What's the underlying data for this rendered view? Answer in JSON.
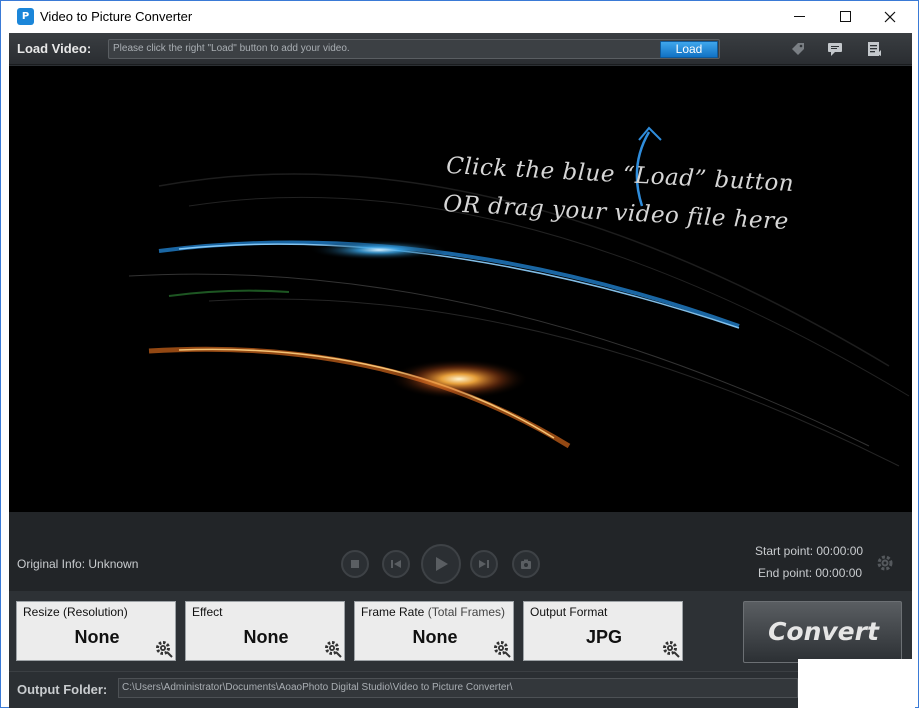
{
  "window": {
    "title": "Video to Picture Converter",
    "app_icon_glyph": "P",
    "controls": [
      "minimize",
      "maximize",
      "close"
    ]
  },
  "load_bar": {
    "label": "Load Video:",
    "input_placeholder": "Please click the right \"Load\" button to add your video.",
    "load_button": "Load",
    "icons": [
      "tag-icon",
      "chat-icon",
      "list-icon"
    ]
  },
  "preview": {
    "hint_line1": "Click the blue “Load” button",
    "hint_line2": "OR drag your video file here"
  },
  "playback": {
    "original_info": "Original Info: Unknown",
    "buttons": [
      "stop-icon",
      "previous-icon",
      "play-icon",
      "next-icon",
      "camera-icon"
    ],
    "start_point": "Start point: 00:00:00",
    "end_point": "End point: 00:00:00"
  },
  "settings": {
    "resize": {
      "label": "Resize (Resolution)",
      "value": "None"
    },
    "effect": {
      "label": "Effect",
      "value": "None"
    },
    "frame_rate": {
      "label": "Frame Rate",
      "sublabel": "(Total Frames)",
      "value": "None"
    },
    "output_format": {
      "label": "Output Format",
      "value": "JPG"
    }
  },
  "convert_button": "Convert",
  "output": {
    "label": "Output Folder:",
    "path": "C:\\Users\\Administrator\\Documents\\AoaoPhoto Digital Studio\\Video to Picture Converter\\"
  },
  "colors": {
    "accent_blue": "#1b86d9",
    "panel_bg": "#ececec",
    "app_bg": "#2b2f33"
  }
}
